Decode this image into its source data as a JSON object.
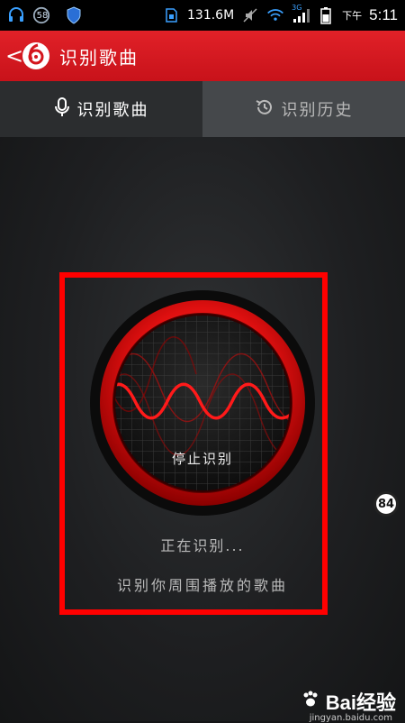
{
  "status_bar": {
    "notif_count": "58",
    "data_usage": "131.6M",
    "network_label": "3G",
    "ampm": "下午",
    "time": "5:11"
  },
  "header": {
    "back_glyph": "<",
    "title": "识别歌曲"
  },
  "tabs": [
    {
      "label": "识别歌曲",
      "icon": "microphone-icon",
      "active": true
    },
    {
      "label": "识别历史",
      "icon": "history-icon",
      "active": false
    }
  ],
  "recognizer": {
    "stop_label": "停止识别",
    "status_text": "正在识别...",
    "hint_text": "识别你周围播放的歌曲"
  },
  "floating_badge": "84",
  "watermark": {
    "brand": "Bai经验",
    "url": "jingyan.baidu.com"
  },
  "colors": {
    "header_red": "#d4161d",
    "frame_red": "#ff0000",
    "active_tab": "#2b2d2f",
    "inactive_tab": "#45484b"
  }
}
